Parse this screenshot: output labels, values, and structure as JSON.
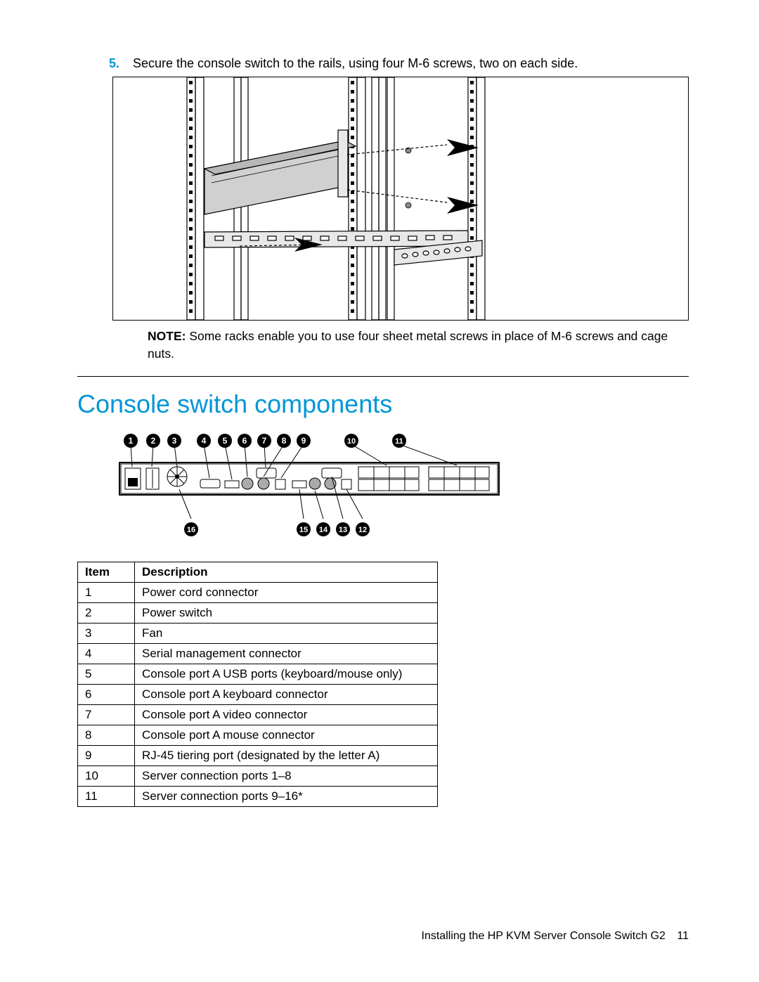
{
  "step": {
    "number": "5.",
    "text": "Secure the console switch to the rails, using four M-6 screws, two on each side."
  },
  "note": {
    "label": "NOTE:",
    "text": "Some racks enable you to use four sheet metal screws in place of M-6 screws and cage nuts."
  },
  "heading": "Console switch components",
  "callouts_top": [
    "1",
    "2",
    "3",
    "4",
    "5",
    "6",
    "7",
    "8",
    "9",
    "10",
    "11"
  ],
  "callouts_bottom": [
    "16",
    "15",
    "14",
    "13",
    "12"
  ],
  "table": {
    "headers": [
      "Item",
      "Description"
    ],
    "rows": [
      [
        "1",
        "Power cord connector"
      ],
      [
        "2",
        "Power switch"
      ],
      [
        "3",
        "Fan"
      ],
      [
        "4",
        "Serial management connector"
      ],
      [
        "5",
        "Console port A USB ports (keyboard/mouse only)"
      ],
      [
        "6",
        "Console port A keyboard connector"
      ],
      [
        "7",
        "Console port A video connector"
      ],
      [
        "8",
        "Console port A mouse connector"
      ],
      [
        "9",
        "RJ-45 tiering port (designated by the letter A)"
      ],
      [
        "10",
        "Server connection ports 1–8"
      ],
      [
        "11",
        "Server connection ports 9–16*"
      ]
    ]
  },
  "footer": {
    "text": "Installing the HP KVM Server Console Switch G2",
    "page": "11"
  }
}
